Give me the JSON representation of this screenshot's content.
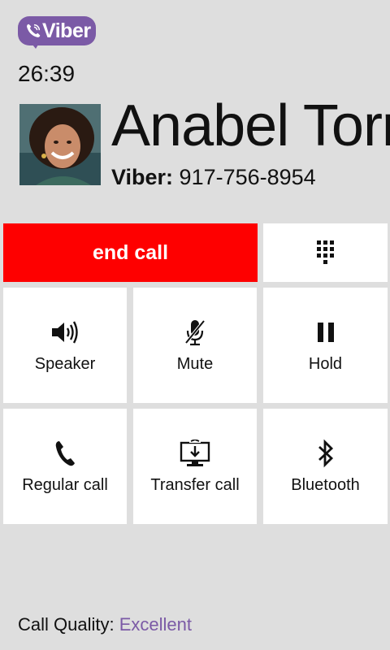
{
  "app": {
    "logo_text": "Viber",
    "accent": "#7b5aa6",
    "end_call_color": "#fe0000"
  },
  "call": {
    "elapsed": "26:39",
    "contact_name": "Anabel Torr",
    "number_source": "Viber:",
    "number": "917-756-8954"
  },
  "actions": {
    "end_call": "end call",
    "keypad_icon": "keypad-icon",
    "speaker": "Speaker",
    "mute": "Mute",
    "hold": "Hold",
    "regular_call": "Regular call",
    "transfer_call": "Transfer call",
    "bluetooth": "Bluetooth"
  },
  "footer": {
    "quality_label": "Call Quality:",
    "quality_value": "Excellent"
  }
}
